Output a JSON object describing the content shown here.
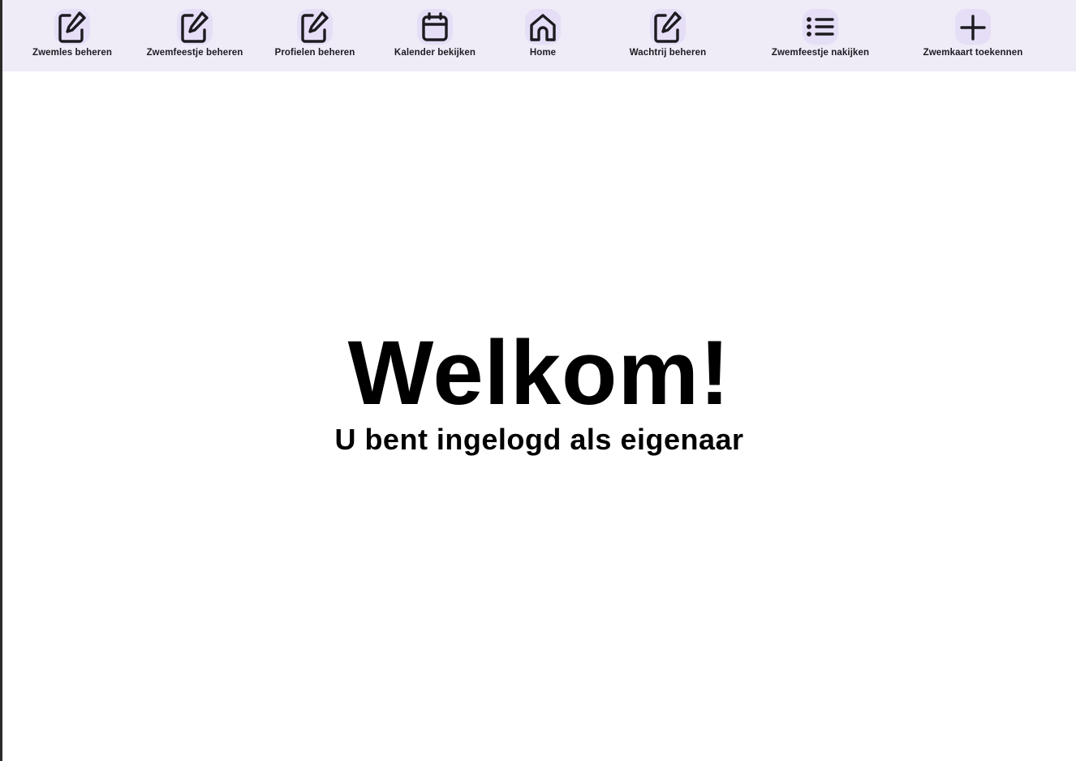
{
  "nav": {
    "items": [
      {
        "label": "Zwemles beheren",
        "icon": "edit-icon"
      },
      {
        "label": "Zwemfeestje beheren",
        "icon": "edit-icon"
      },
      {
        "label": "Profielen beheren",
        "icon": "edit-icon"
      },
      {
        "label": "Kalender bekijken",
        "icon": "calendar-icon"
      },
      {
        "label": "Home",
        "icon": "home-icon"
      },
      {
        "label": "Wachtrij beheren",
        "icon": "edit-icon"
      },
      {
        "label": "Zwemfeestje nakijken",
        "icon": "list-icon"
      },
      {
        "label": "Zwemkaart toekennen",
        "icon": "add-icon"
      }
    ]
  },
  "main": {
    "title": "Welkom!",
    "subtitle": "U bent ingelogd als eigenaar"
  },
  "colors": {
    "nav_background": "#efebf7",
    "icon_indicator": "#e6def6",
    "text": "#1d1b20"
  }
}
